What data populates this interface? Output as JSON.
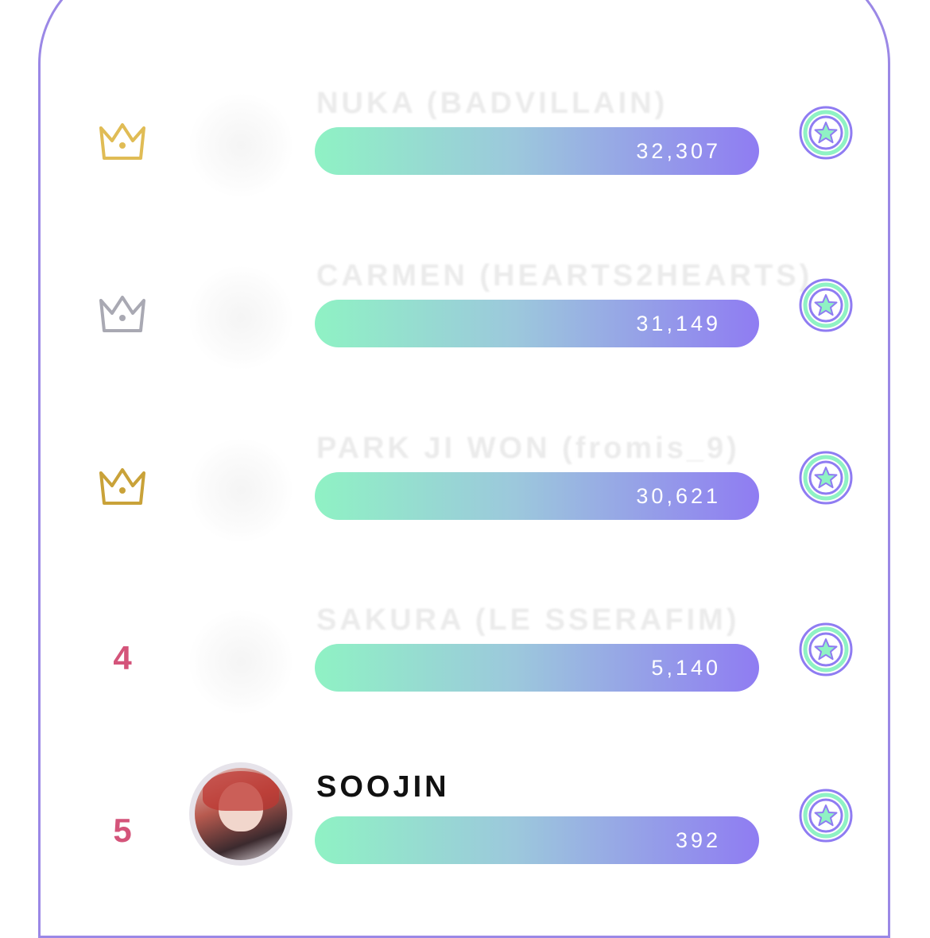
{
  "colors": {
    "card_border": "#9b88e6",
    "bar_start": "#8ff2c4",
    "bar_end": "#8f7cf2",
    "crown_gold": "#e0bc55",
    "crown_silver": "#a9a9b3",
    "crown_bronze": "#c9a239",
    "rank_number": "#d4547a"
  },
  "ranking": [
    {
      "rank_icon": "crown-gold-icon",
      "rank_label": "",
      "name": "NUKA (BADVILLAIN)",
      "votes": "32,307",
      "faded": true
    },
    {
      "rank_icon": "crown-silver-icon",
      "rank_label": "",
      "name": "CARMEN (HEARTS2HEARTS)",
      "votes": "31,149",
      "faded": true
    },
    {
      "rank_icon": "crown-bronze-icon",
      "rank_label": "",
      "name": "PARK JI WON (fromis_9)",
      "votes": "30,621",
      "faded": true
    },
    {
      "rank_icon": "",
      "rank_label": "4",
      "name": "SAKURA (LE SSERAFIM)",
      "votes": "5,140",
      "faded": true
    },
    {
      "rank_icon": "",
      "rank_label": "5",
      "name": "SOOJIN",
      "votes": "392",
      "faded": false
    }
  ],
  "vote_button_icon": "star-vote-icon"
}
